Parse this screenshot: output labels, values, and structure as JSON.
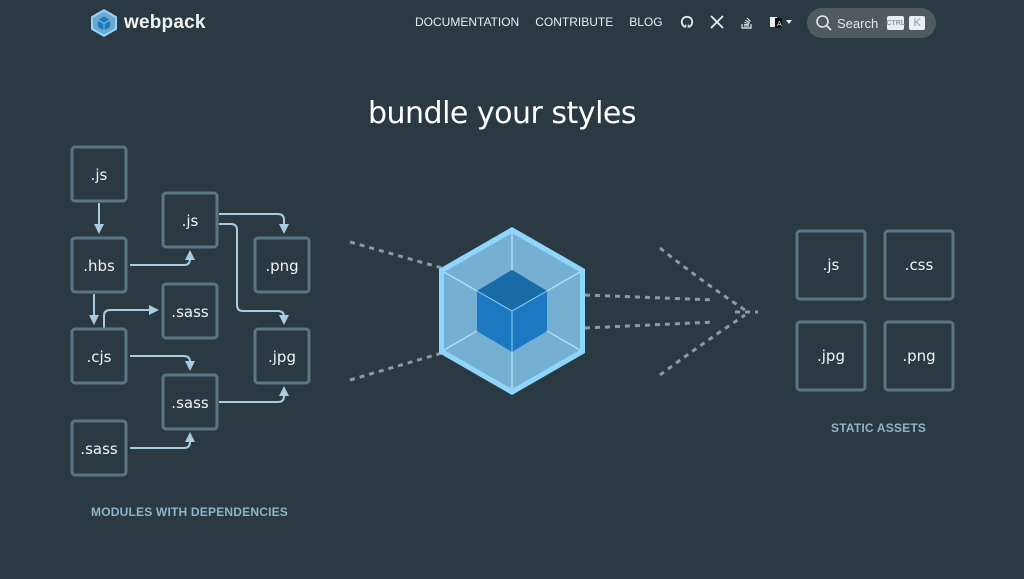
{
  "header": {
    "logo_text": "webpack",
    "nav_links": [
      "DOCUMENTATION",
      "CONTRIBUTE",
      "BLOG"
    ],
    "icons": [
      "github-icon",
      "x-twitter-icon",
      "stack-overflow-icon",
      "language-icon",
      "theme-toggle-icon"
    ],
    "search": {
      "label": "Search",
      "shortcut_modifier": "CTRL",
      "shortcut_key": "K"
    }
  },
  "hero": {
    "title": "bundle your styles"
  },
  "modules": {
    "caption": "MODULES WITH DEPENDENCIES",
    "boxes": [
      ".js",
      ".hbs",
      ".cjs",
      ".sass",
      ".js",
      ".sass",
      ".sass",
      ".png",
      ".jpg"
    ]
  },
  "assets": {
    "caption": "STATIC ASSETS",
    "boxes": [
      ".js",
      ".css",
      ".jpg",
      ".png"
    ]
  },
  "colors": {
    "background": "#2b3a42",
    "box_stroke": "#5a7585",
    "arrow": "#a9cbe0",
    "caption": "#8db4cc",
    "cube_outer": "#8ed6fb",
    "cube_inner": "#1c78c0"
  }
}
